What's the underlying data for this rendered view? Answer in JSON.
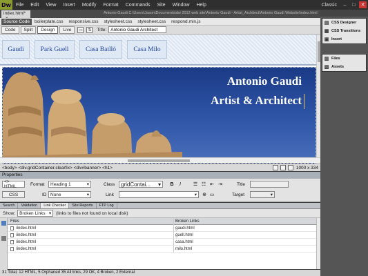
{
  "app": {
    "logo": "Dw",
    "menu": [
      "File",
      "Edit",
      "View",
      "Insert",
      "Modify",
      "Format",
      "Commands",
      "Site",
      "Window",
      "Help"
    ],
    "workspace": "Classic",
    "window_controls": [
      "–",
      "□",
      "✕"
    ]
  },
  "document": {
    "tab_label": "index.html*",
    "tab_close": "×",
    "path": "Antonio Gaudi    C:\\Users\\Jason\\Documents\\dw 2012 web site\\Antonio Gaudi - Artist_Architect\\Antonio Gaudi Website\\index.html"
  },
  "related_files": {
    "source": "Source Code",
    "files": [
      "boilerplate.css",
      "responsive.css",
      "stylesheet.css",
      "stylesheet.css",
      "respond.min.js"
    ]
  },
  "doc_toolbar": {
    "views": [
      "Code",
      "Split",
      "Design",
      "Live"
    ],
    "active_view": "Design",
    "title_label": "Title:",
    "title_value": "Antonio Gaudi Architect"
  },
  "design": {
    "nav_links": [
      "Gaudi",
      "Park Guell",
      "Casa Batlló",
      "Casa Milo"
    ],
    "h1_line1": "Antonio Gaudi",
    "h1_line2": "Artist & Architect"
  },
  "statusbar": {
    "tag_path": "<body> <div.gridContainer.clearfix> <div#banner> <h1>",
    "window_size": "1000 x 334"
  },
  "properties": {
    "header": "Properties",
    "html_btn": "<> HTML",
    "css_btn": "CSS",
    "format_label": "Format",
    "format_value": "Heading 1",
    "id_label": "ID",
    "id_value": "None",
    "class_label": "Class",
    "class_value": "gridContai...",
    "link_label": "Link",
    "link_value": "",
    "title_label": "Title",
    "target_label": "Target",
    "bold": "B",
    "italic": "I"
  },
  "results": {
    "tabs": [
      "Search",
      "Validation",
      "Link Checker",
      "Site Reports",
      "FTP Log"
    ],
    "active_tab": "Link Checker",
    "show_label": "Show:",
    "show_value": "Broken Links",
    "show_note": "(links to files not found on local disk)",
    "columns": [
      "Files",
      "Broken Links"
    ],
    "rows": [
      {
        "file": "/index.html",
        "broken": "gaudi.html"
      },
      {
        "file": "/index.html",
        "broken": "guell.html"
      },
      {
        "file": "/index.html",
        "broken": "casa.html"
      },
      {
        "file": "/index.html",
        "broken": "milo.html"
      }
    ],
    "summary": "31 Total, 12 HTML, 5 Orphaned  35 All links, 29 OK, 4 Broken, 2 External"
  },
  "dock": {
    "group1": [
      "CSS Designer",
      "CSS Transitions",
      "Insert"
    ],
    "group2": [
      "Files",
      "Assets"
    ]
  }
}
